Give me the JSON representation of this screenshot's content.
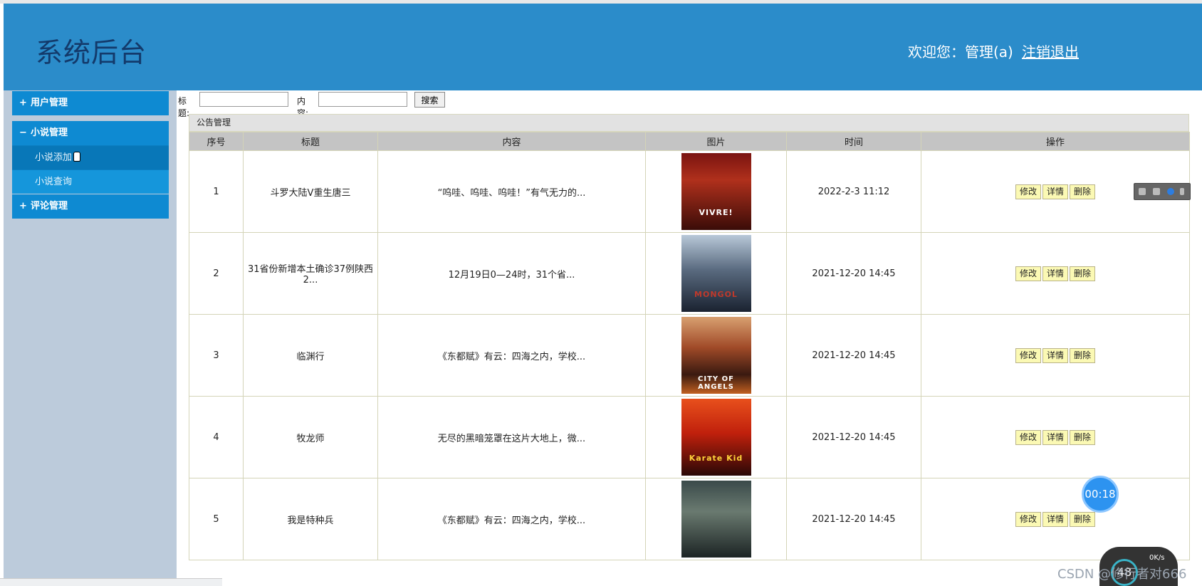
{
  "header": {
    "title": "系统后台",
    "welcome": "欢迎您：管理(a)",
    "logout": "注销退出"
  },
  "sidebar": {
    "groups": [
      {
        "sign": "+",
        "label": "用户管理"
      },
      {
        "sign": "−",
        "label": "小说管理",
        "items": [
          "小说添加",
          "小说查询"
        ]
      },
      {
        "sign": "+",
        "label": "评论管理"
      }
    ]
  },
  "search": {
    "title_label": "标题:",
    "title_value": "",
    "content_label": "内容:",
    "content_value": "",
    "button": "搜索"
  },
  "panel": {
    "title": "公告管理"
  },
  "table": {
    "headers": [
      "序号",
      "标题",
      "内容",
      "图片",
      "时间",
      "操作"
    ],
    "rows": [
      {
        "no": "1",
        "title": "斗罗大陆V重生唐三",
        "content": "“呜哇、呜哇、呜哇！”有气无力的...",
        "poster_text": "VIVRE!",
        "time": "2022-2-3 11:12"
      },
      {
        "no": "2",
        "title": "31省份新增本土确诊37例陕西2...",
        "content": "12月19日0—24时，31个省...",
        "poster_text": "MONGOL",
        "time": "2021-12-20 14:45"
      },
      {
        "no": "3",
        "title": "临渊行",
        "content": "《东都赋》有云：四海之内，学校...",
        "poster_text": "CITY OF ANGELS",
        "time": "2021-12-20 14:45"
      },
      {
        "no": "4",
        "title": "牧龙师",
        "content": "无尽的黑暗笼罩在这片大地上，微...",
        "poster_text": "Karate Kid",
        "time": "2021-12-20 14:45"
      },
      {
        "no": "5",
        "title": "我是特种兵",
        "content": "《东都赋》有云：四海之内，学校...",
        "poster_text": "",
        "time": "2021-12-20 14:45"
      }
    ],
    "ops": [
      "修改",
      "详情",
      "删除"
    ]
  },
  "overlays": {
    "timer": "00:18",
    "speed_number": "48",
    "speed_rate": "0K/s",
    "watermark": "CSDN @修行者对666"
  },
  "colors": {
    "header_bg": "#2b8cca",
    "nav_bg": "#0e8ad2",
    "sidebar_bg": "#bccbdb",
    "op_button_bg": "#fbf9b4"
  }
}
